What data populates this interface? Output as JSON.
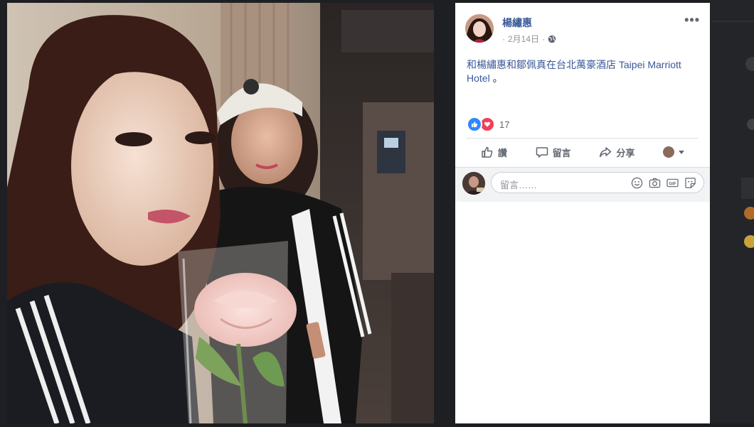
{
  "post": {
    "author": "楊繡惠",
    "date": "2月14日",
    "text_link1": "和楊繡惠和鄒佩真在台北萬豪酒店 Taipei Marriott Hotel",
    "text_tail": "。",
    "reaction_count": "17"
  },
  "actions": {
    "like": "讚",
    "comment": "留言",
    "share": "分享"
  },
  "comment_input": {
    "placeholder": "留言……"
  },
  "icons": {
    "more": "more-horizontal-icon",
    "privacy": "globe-icon",
    "like_reaction": "thumbs-up-icon",
    "love_reaction": "heart-icon",
    "emoji": "emoji-icon",
    "camera": "camera-icon",
    "gif": "gif-icon",
    "sticker": "sticker-icon"
  },
  "colors": {
    "link": "#385898",
    "like_blue": "#2d88ff",
    "love_red": "#f33e58"
  }
}
